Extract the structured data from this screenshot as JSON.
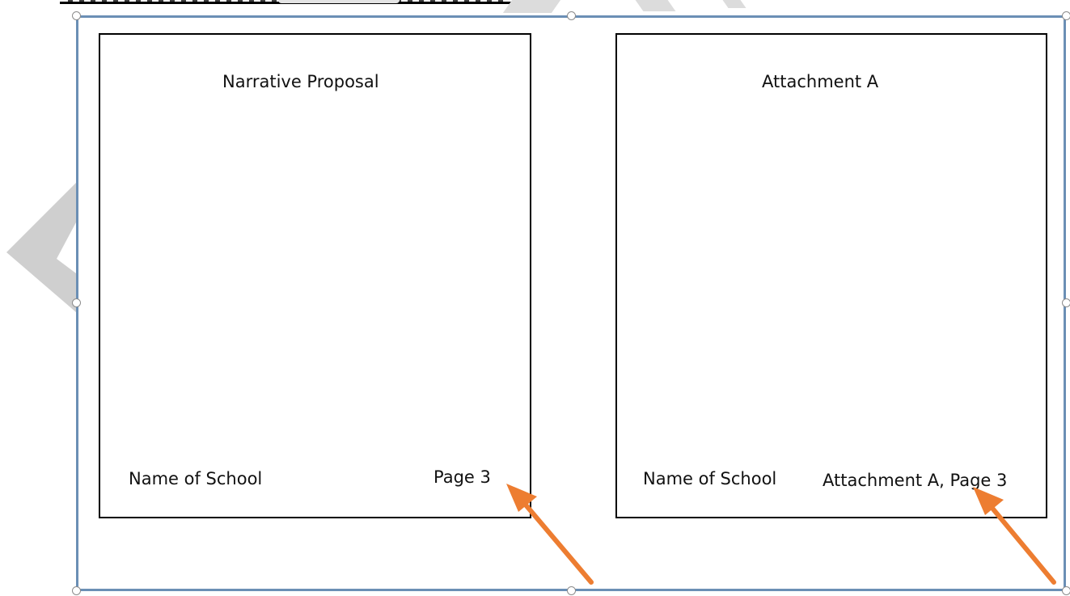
{
  "colors": {
    "frame_border": "#6b8fb5",
    "handle_fill": "#ffffff",
    "handle_border": "#8c8c8c",
    "page_border": "#000000",
    "arrow": "#ed7d31",
    "watermark": "#cfcfcf"
  },
  "left_page": {
    "title": "Narrative Proposal",
    "footer_left": "Name of School",
    "footer_right": "Page 3"
  },
  "right_page": {
    "title": "Attachment A",
    "footer_left": "Name of School",
    "footer_right": "Attachment A, Page 3"
  },
  "icons": {
    "left_arrow": "orange-arrow-icon",
    "right_arrow": "orange-arrow-icon",
    "watermark": "left-chevron-watermark-icon"
  }
}
